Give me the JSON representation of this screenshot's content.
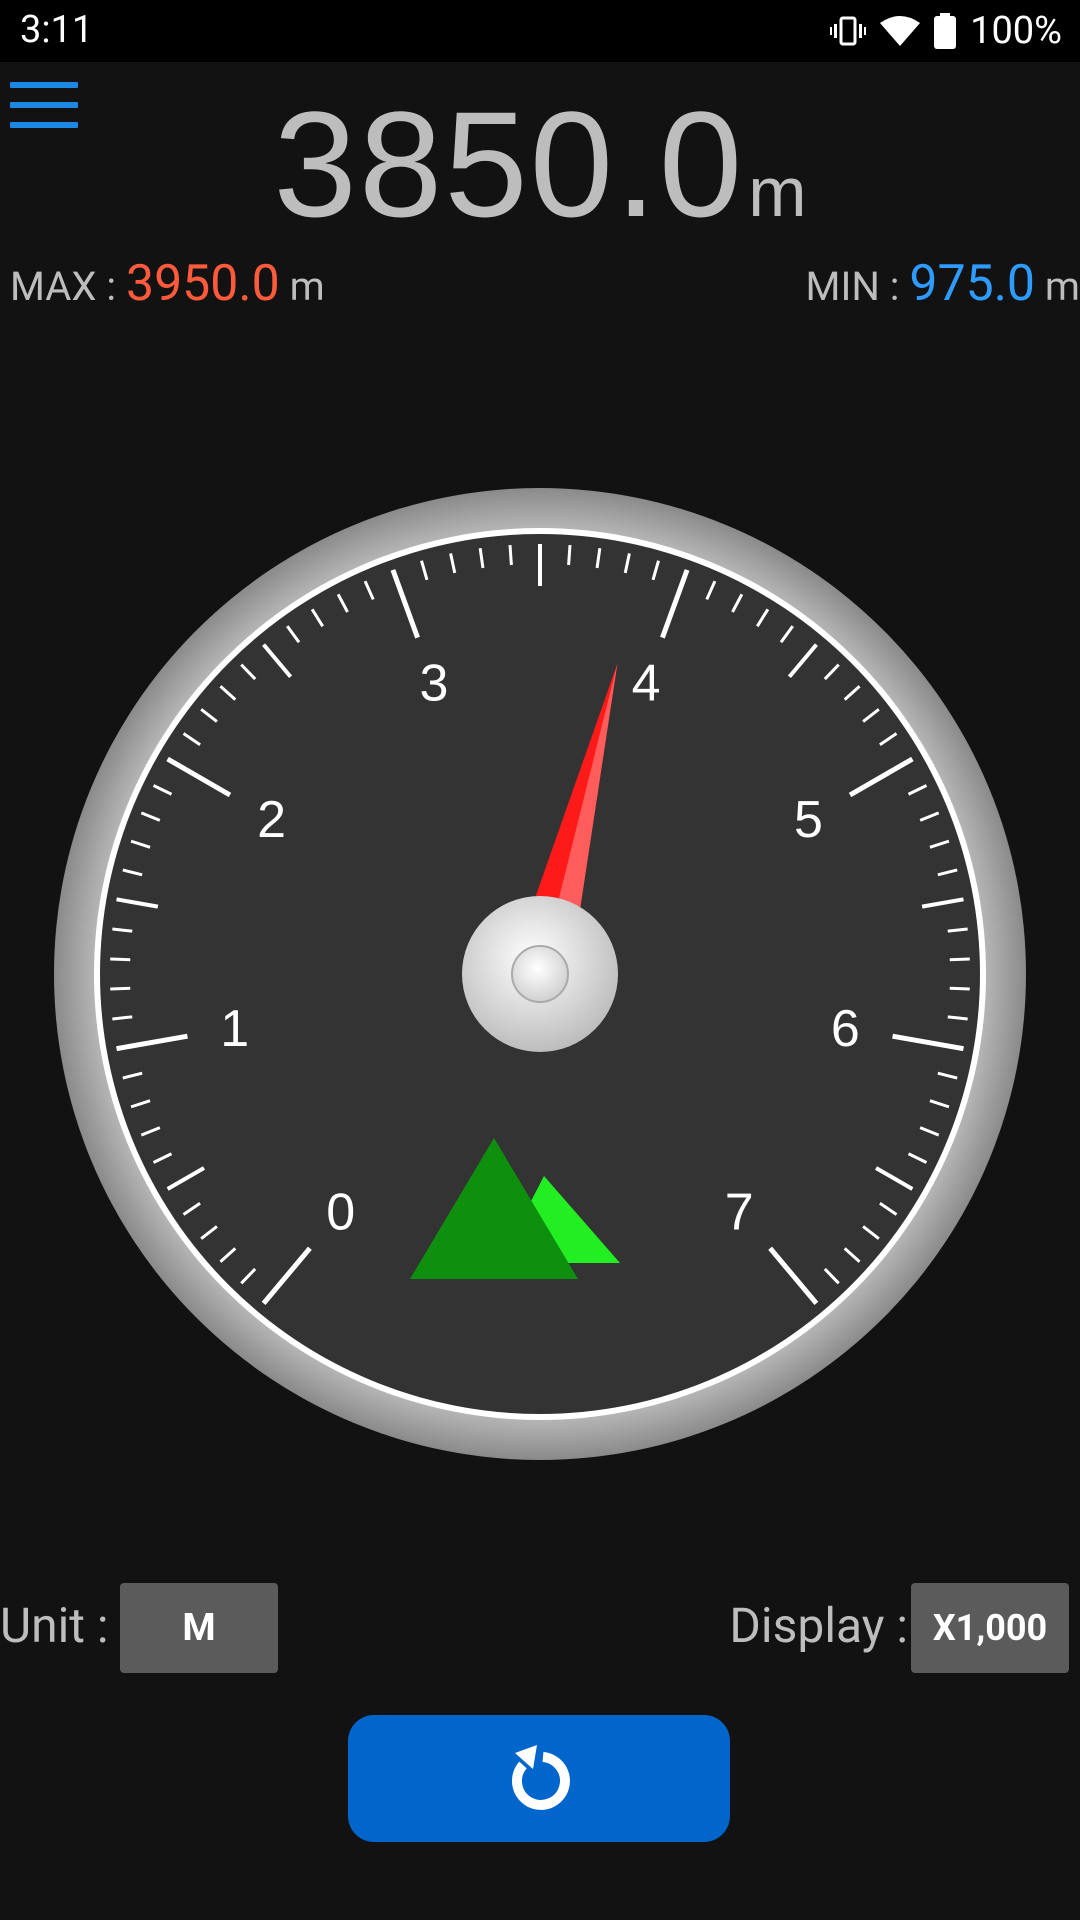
{
  "status_bar": {
    "time": "3:11",
    "battery_text": "100%",
    "icons": [
      "vibrate-icon",
      "wifi-icon",
      "battery-icon"
    ]
  },
  "altitude": {
    "value": "3850.0",
    "unit": "m"
  },
  "max": {
    "label": "MAX : ",
    "value": "3950.0",
    "unit": " m"
  },
  "min": {
    "label": "MIN : ",
    "value": "975.0",
    "unit": " m"
  },
  "gauge": {
    "labels": [
      "0",
      "1",
      "2",
      "3",
      "4",
      "5",
      "6",
      "7"
    ],
    "reading_thousands": 3.85,
    "needle_color": "#ff1a1a",
    "mountain_colors": [
      "#0e8f0e",
      "#22ee22"
    ]
  },
  "controls": {
    "unit_label": "Unit :",
    "unit_value": "M",
    "display_label": "Display :",
    "display_value": "X1,000",
    "reset_icon": "refresh-icon"
  },
  "colors": {
    "accent": "#1e88e5",
    "max": "#ff5a3c",
    "min": "#2e9bff",
    "button": "#0066cc"
  }
}
